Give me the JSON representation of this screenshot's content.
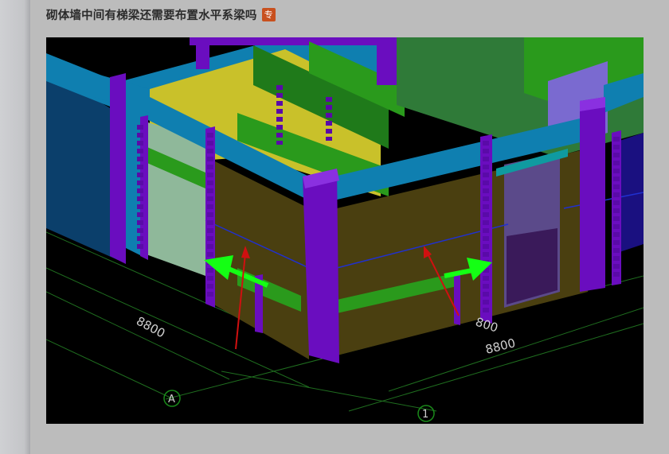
{
  "post": {
    "title": "砌体墙中间有梯梁还需要布置水平系梁吗",
    "badge": "专"
  },
  "figure": {
    "dimension_labels": [
      "8800",
      "800",
      "8800"
    ],
    "axis_labels": [
      "A",
      "1"
    ],
    "colors": {
      "background": "#000000",
      "beam_blue": "#0f7fb0",
      "column_purple": "#6a0dbf",
      "slab_green": "#2a9a1c",
      "wall_olive": "#4a3f10",
      "floor_yellow": "#c9c12a",
      "arrow_green": "#14ff14",
      "arrow_red": "#d01010"
    }
  }
}
